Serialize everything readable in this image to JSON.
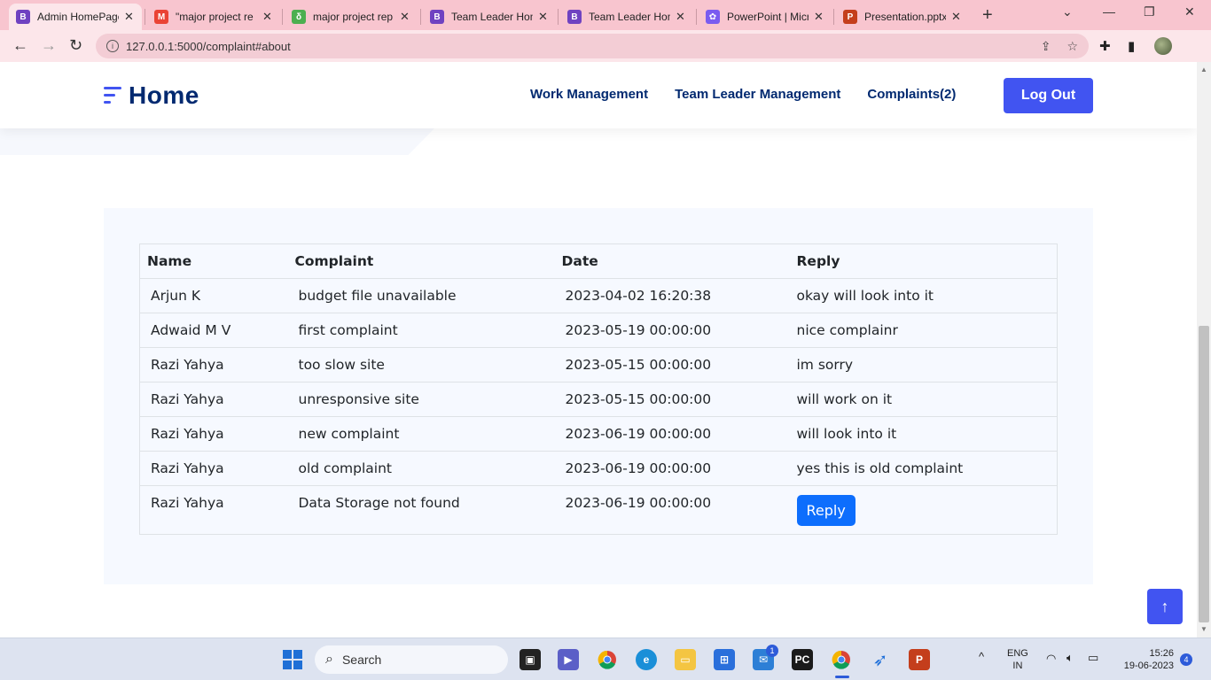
{
  "browser": {
    "tabs": [
      {
        "title": "Admin HomePage",
        "icon": "bootstrap-icon",
        "color": "#6f42c1",
        "glyph": "B"
      },
      {
        "title": "\"major project re",
        "icon": "gmail-icon",
        "color": "#ea4335",
        "glyph": "M"
      },
      {
        "title": "major project rep",
        "icon": "overleaf-icon",
        "color": "#4caf50",
        "glyph": "δ"
      },
      {
        "title": "Team Leader Hom",
        "icon": "bootstrap-icon",
        "color": "#6f42c1",
        "glyph": "B"
      },
      {
        "title": "Team Leader Hom",
        "icon": "bootstrap-icon",
        "color": "#6f42c1",
        "glyph": "B"
      },
      {
        "title": "PowerPoint | Micr",
        "icon": "microsoft365-icon",
        "color": "#7a5cf0",
        "glyph": "✿"
      },
      {
        "title": "Presentation.pptx",
        "icon": "powerpoint-icon",
        "color": "#c43e1c",
        "glyph": "P"
      }
    ],
    "url": "127.0.0.1:5000/complaint#about"
  },
  "site": {
    "brand": "Home",
    "nav": [
      "Work Management",
      "Team Leader Management",
      "Complaints(2)"
    ],
    "logout_label": "Log Out"
  },
  "table": {
    "headers": [
      "Name",
      "Complaint",
      "Date",
      "Reply"
    ],
    "rows": [
      {
        "name": "Arjun K",
        "complaint": "budget file unavailable",
        "date": "2023-04-02 16:20:38",
        "reply": "okay will look into it"
      },
      {
        "name": "Adwaid M V",
        "complaint": "first complaint",
        "date": "2023-05-19 00:00:00",
        "reply": "nice complainr"
      },
      {
        "name": "Razi Yahya",
        "complaint": "too slow site",
        "date": "2023-05-15 00:00:00",
        "reply": "im sorry"
      },
      {
        "name": "Razi Yahya",
        "complaint": "unresponsive site",
        "date": "2023-05-15 00:00:00",
        "reply": "will work on it"
      },
      {
        "name": "Razi Yahya",
        "complaint": "new complaint",
        "date": "2023-06-19 00:00:00",
        "reply": "will look into it"
      },
      {
        "name": "Razi Yahya",
        "complaint": "old complaint",
        "date": "2023-06-19 00:00:00",
        "reply": "yes this is old complaint"
      },
      {
        "name": "Razi Yahya",
        "complaint": "Data Storage not found",
        "date": "2023-06-19 00:00:00",
        "reply": ""
      }
    ],
    "reply_button_label": "Reply"
  },
  "taskbar": {
    "search_label": "Search",
    "language": "ENG",
    "region": "IN",
    "time": "15:26",
    "date": "19-06-2023",
    "notification_count": "4",
    "mail_badge": "1"
  },
  "colors": {
    "accent": "#4154f1",
    "brand_text": "#012970",
    "reply_button": "#0d6efd",
    "tabstrip": "#f8c5cf"
  }
}
